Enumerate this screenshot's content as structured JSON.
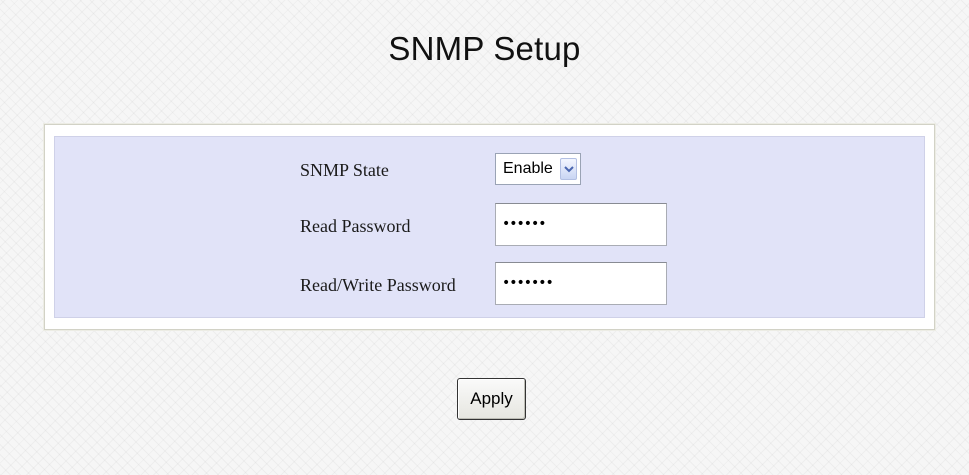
{
  "page": {
    "title": "SNMP Setup"
  },
  "form": {
    "snmp_state": {
      "label": "SNMP State",
      "selected": "Enable"
    },
    "read_password": {
      "label": "Read Password",
      "masked_value": "••••••"
    },
    "read_write_password": {
      "label": "Read/Write Password",
      "masked_value": "•••••••"
    }
  },
  "actions": {
    "apply_label": "Apply"
  },
  "icons": {
    "select_arrow": "chevron-down-icon"
  },
  "colors": {
    "panel_background": "#e1e3f8",
    "page_background": "#f6f6f6"
  }
}
